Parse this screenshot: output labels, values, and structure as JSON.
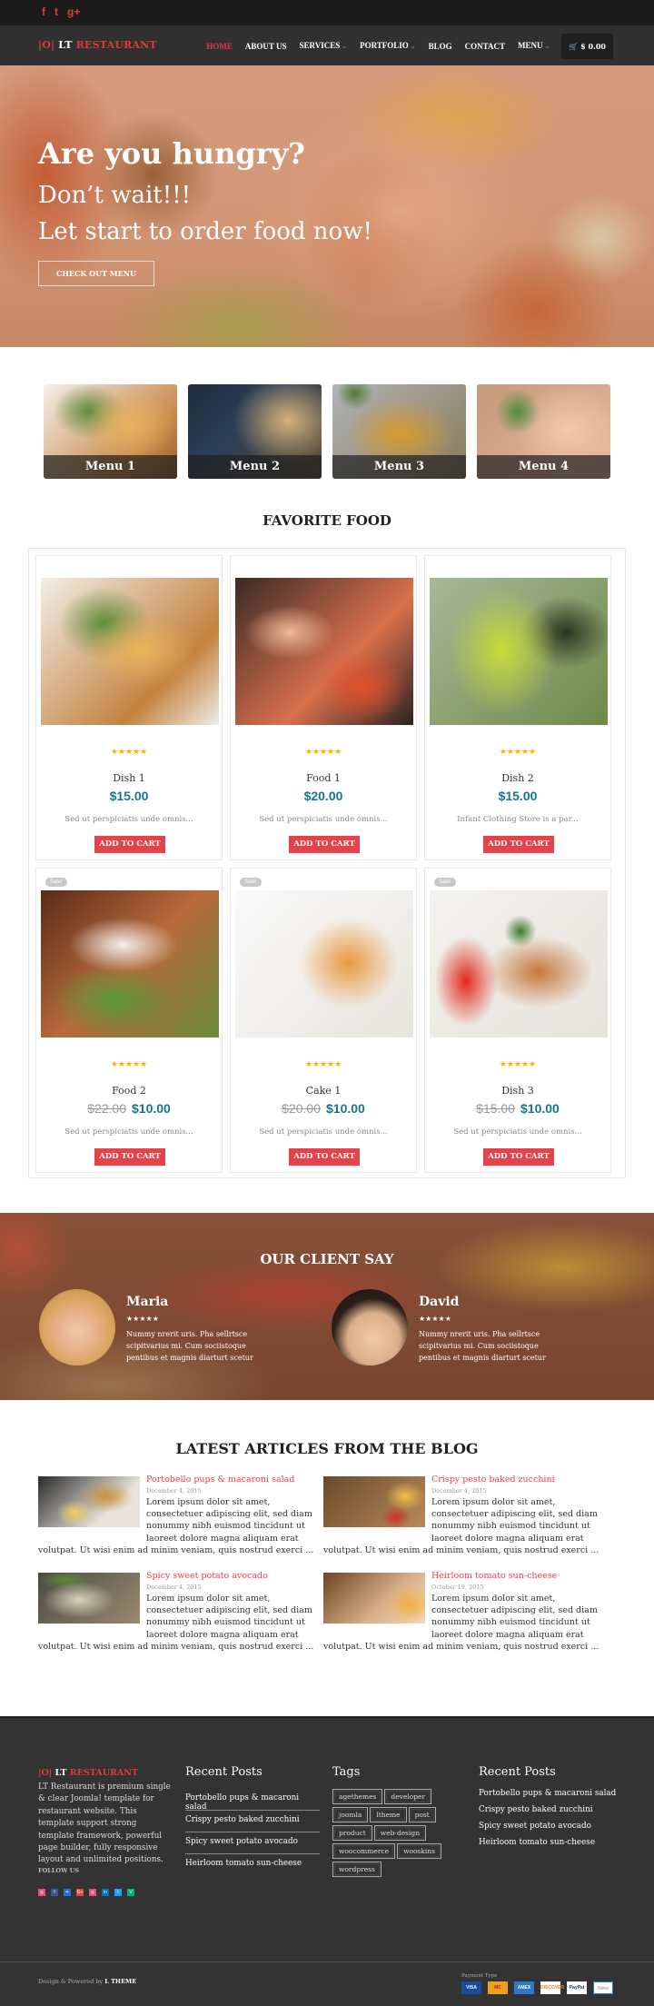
{
  "topbar": {
    "social": [
      {
        "icon": "facebook-icon",
        "glyph": "f"
      },
      {
        "icon": "twitter-icon",
        "glyph": "t"
      },
      {
        "icon": "google-plus-icon",
        "glyph": "g+"
      }
    ]
  },
  "header": {
    "logo_icon": "|O|",
    "logo_lt": "LT",
    "logo_name": "RESTAURANT",
    "nav": [
      {
        "label": "HOME",
        "active": true,
        "dropdown": false
      },
      {
        "label": "ABOUT US",
        "active": false,
        "dropdown": false
      },
      {
        "label": "SERVICES",
        "active": false,
        "dropdown": true
      },
      {
        "label": "PORTFOLIO",
        "active": false,
        "dropdown": true
      },
      {
        "label": "BLOG",
        "active": false,
        "dropdown": false
      },
      {
        "label": "CONTACT",
        "active": false,
        "dropdown": false
      },
      {
        "label": "MENU",
        "active": false,
        "dropdown": true
      }
    ],
    "cart_icon": "🛒",
    "cart_total": "$ 0.00",
    "chevron": "⌄"
  },
  "hero": {
    "title": "Are you hungry?",
    "line2": "Don’t wait!!!",
    "line3": "Let start to order food now!",
    "button": "CHECK OUT MENU"
  },
  "menus": [
    "Menu 1",
    "Menu 2",
    "Menu 3",
    "Menu 4"
  ],
  "favorite": {
    "title": "FAVORITE FOOD",
    "add_label": "ADD TO CART",
    "stars": "★★★★★",
    "rating": 5,
    "sale_label": "Sale!",
    "items": [
      {
        "name": "Dish 1",
        "old_price": "",
        "price": "$15.00",
        "desc": "Sed ut perspiciatis unde omnis...",
        "sale": false
      },
      {
        "name": "Food 1",
        "old_price": "",
        "price": "$20.00",
        "desc": "Sed ut perspiciatis unde omnis...",
        "sale": false
      },
      {
        "name": "Dish 2",
        "old_price": "",
        "price": "$15.00",
        "desc": "Infant Clothing Store is a par...",
        "sale": false
      },
      {
        "name": "Food 2",
        "old_price": "$22.00",
        "price": "$10.00",
        "desc": "Sed ut perspiciatis unde omnis...",
        "sale": true
      },
      {
        "name": "Cake 1",
        "old_price": "$20.00",
        "price": "$10.00",
        "desc": "Sed ut perspiciatis unde omnis...",
        "sale": true
      },
      {
        "name": "Dish 3",
        "old_price": "$15.00",
        "price": "$10.00",
        "desc": "Sed ut perspiciatis unde omnis...",
        "sale": true
      }
    ]
  },
  "testimonials": {
    "title": "OUR CLIENT SAY",
    "stars": "★★★★★",
    "clients": [
      {
        "name": "Maria",
        "rating": 5,
        "text": "Nummy nrerit uris. Pha sellrtsce scipitvarius mi. Cum sociistoque pentibus et magnis diarturt scetur"
      },
      {
        "name": "David",
        "rating": 5,
        "text": "Nummy nrerit uris. Pha sellrtsce scipitvarius mi. Cum sociistoque pentibus et magnis diarturt scetur"
      }
    ]
  },
  "blog": {
    "title": "LATEST ARTICLES FROM THE BLOG",
    "posts": [
      {
        "title": "Portobello pups & macaroni salad",
        "date": "December 4, 2015",
        "excerpt": "Lorem ipsum dolor sit amet, consectetuer adipiscing elit, sed diam nonummy nibh euismod tincidunt ut laoreet dolore magna aliquam erat volutpat. Ut wisi enim ad minim veniam, quis nostrud exerci ..."
      },
      {
        "title": "Crispy pesto baked zucchini",
        "date": "December 4, 2015",
        "excerpt": "Lorem ipsum dolor sit amet, consectetuer adipiscing elit, sed diam nonummy nibh euismod tincidunt ut laoreet dolore magna aliquam erat volutpat. Ut wisi enim ad minim veniam, quis nostrud exerci ..."
      },
      {
        "title": "Spicy sweet potato avocado",
        "date": "December 4, 2015",
        "excerpt": "Lorem ipsum dolor sit amet, consectetuer adipiscing elit, sed diam nonummy nibh euismod tincidunt ut laoreet dolore magna aliquam erat volutpat. Ut wisi enim ad minim veniam, quis nostrud exerci ..."
      },
      {
        "title": "Heirloom tomato sun-cheese",
        "date": "October 19, 2015",
        "excerpt": "Lorem ipsum dolor sit amet, consectetuer adipiscing elit, sed diam nonummy nibh euismod tincidunt ut laoreet dolore magna aliquam erat volutpat. Ut wisi enim ad minim veniam, quis nostrud exerci ..."
      }
    ]
  },
  "footer": {
    "logo_icon": "|O|",
    "logo_lt": "LT",
    "logo_name": "RESTAURANT",
    "about": "LT Restaurant is premium single & clear Joomla! template for restaurant website. This template support strong template framework, powerful page builder, fully responsive layout and unlimited positions.",
    "follow": "FOLLOW US",
    "socials": [
      {
        "icon": "dribbble-icon",
        "glyph": "◎",
        "color": "#e04c86"
      },
      {
        "icon": "facebook-icon",
        "glyph": "f",
        "color": "#3b5998"
      },
      {
        "icon": "flickr-icon",
        "glyph": "••",
        "color": "#2a6bd8"
      },
      {
        "icon": "google-plus-icon",
        "glyph": "G+",
        "color": "#dd4b39"
      },
      {
        "icon": "instagram-icon",
        "glyph": "◎",
        "color": "#e04c86"
      },
      {
        "icon": "linkedin-icon",
        "glyph": "in",
        "color": "#0077b5"
      },
      {
        "icon": "twitter-icon",
        "glyph": "t",
        "color": "#1da1f2"
      },
      {
        "icon": "vine-icon",
        "glyph": "V",
        "color": "#00b488"
      }
    ],
    "recent1_title": "Recent Posts",
    "recent1": [
      "Portobello pups & macaroni salad",
      "Crispy pesto baked zucchini",
      "Spicy sweet potato avocado",
      "Heirloom tomato sun-cheese"
    ],
    "tags_title": "Tags",
    "tags": [
      "agethemes",
      "developer",
      "joomla",
      "ltheme",
      "post",
      "product",
      "web-design",
      "woocommerce",
      "wooskins",
      "wordpress"
    ],
    "recent2_title": "Recent Posts",
    "recent2": [
      "Portobello pups & macaroni salad",
      "Crispy pesto baked zucchini",
      "Spicy sweet potato avocado",
      "Heirloom tomato sun-cheese"
    ],
    "copyright_prefix": "Design & Powered by",
    "copyright_brand": "L THEME",
    "payment_title": "Payment Type",
    "payments": [
      {
        "icon": "visa-icon",
        "label": "VISA",
        "bg": "#1a4a9a",
        "fg": "#fff"
      },
      {
        "icon": "mastercard-icon",
        "label": "MC",
        "bg": "#f0a020",
        "fg": "#c01828"
      },
      {
        "icon": "amex-icon",
        "label": "AMEX",
        "bg": "#2a7ad0",
        "fg": "#fff"
      },
      {
        "icon": "discover-icon",
        "label": "DISCOVER",
        "bg": "#fff",
        "fg": "#e8801a"
      },
      {
        "icon": "paypal-icon",
        "label": "PayPal",
        "bg": "#fff",
        "fg": "#1a3a8a"
      },
      {
        "icon": "none-icon",
        "label": "None",
        "bg": "#fff",
        "fg": "#888"
      }
    ]
  }
}
